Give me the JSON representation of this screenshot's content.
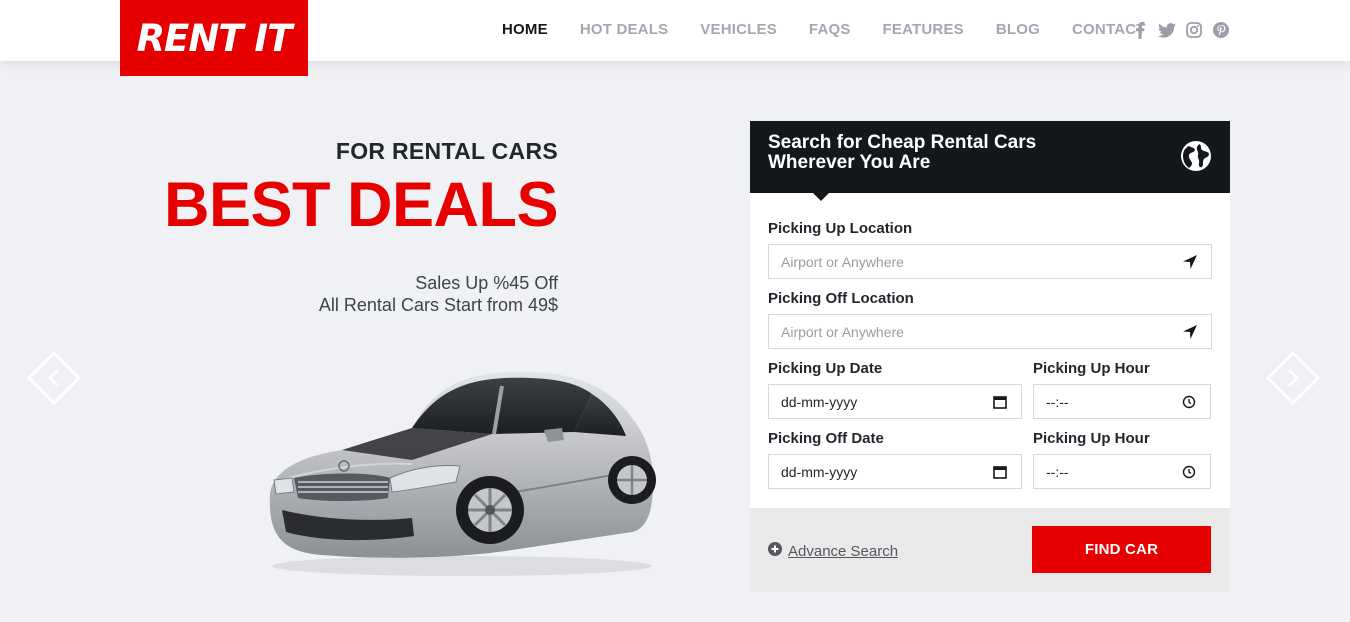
{
  "brand": {
    "logo_text": "RENT IT",
    "accent_color": "#e60000",
    "dark_color": "#14171c"
  },
  "nav": {
    "items": [
      {
        "label": "HOME",
        "active": true
      },
      {
        "label": "HOT DEALS",
        "active": false
      },
      {
        "label": "VEHICLES",
        "active": false
      },
      {
        "label": "FAQS",
        "active": false
      },
      {
        "label": "FEATURES",
        "active": false
      },
      {
        "label": "BLOG",
        "active": false
      },
      {
        "label": "CONTACT",
        "active": false
      }
    ],
    "social_icons": [
      "facebook-icon",
      "twitter-icon",
      "instagram-icon",
      "pinterest-icon"
    ]
  },
  "hero": {
    "subtitle": "FOR RENTAL CARS",
    "title": "BEST DEALS",
    "promo_line1": "Sales Up %45 Off",
    "promo_line2": "All Rental Cars Start from 49$"
  },
  "search": {
    "heading": "Search for Cheap Rental Cars Wherever You Are",
    "pickup_location_label": "Picking Up Location",
    "pickup_location_placeholder": "Airport or Anywhere",
    "dropoff_location_label": "Picking Off Location",
    "dropoff_location_placeholder": "Airport or Anywhere",
    "pickup_date_label": "Picking Up Date",
    "pickup_date_value": "dd-mm-yyyy",
    "pickup_hour_label": "Picking Up Hour",
    "pickup_hour_value": "--:--",
    "dropoff_date_label": "Picking Off Date",
    "dropoff_date_value": "dd-mm-yyyy",
    "dropoff_hour_label": "Picking Up Hour",
    "dropoff_hour_value": "--:--",
    "advance_search_label": "Advance Search",
    "find_button_label": "FIND CAR"
  }
}
